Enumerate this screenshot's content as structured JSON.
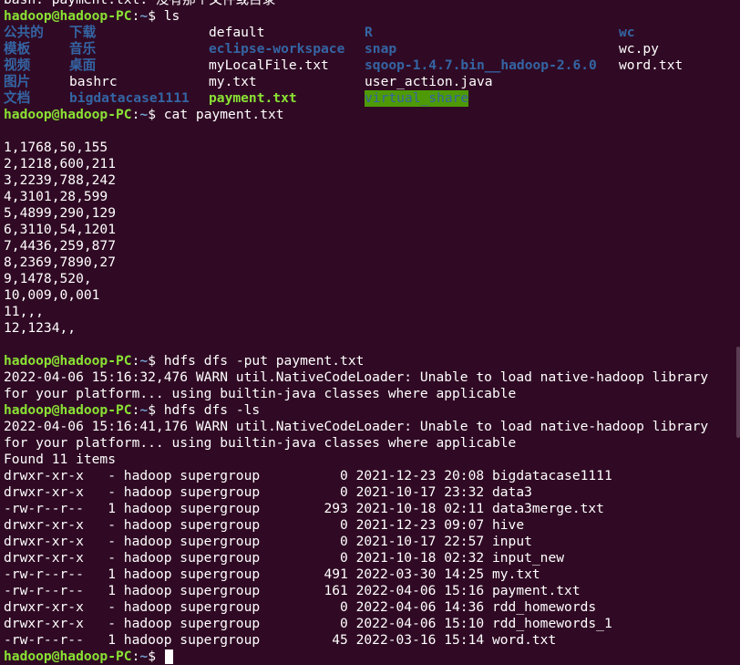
{
  "terminal": {
    "top_partial": "bash: payment.txt: 没有那个文件或目录",
    "prompt_user": "hadoop@hadoop-PC",
    "prompt_path": "~",
    "prompt_suffix": "$ ",
    "commands": {
      "ls": "ls",
      "cat": "cat payment.txt",
      "put": "hdfs dfs -put payment.txt",
      "hdfs_ls": "hdfs dfs -ls"
    },
    "ls_output": {
      "rows": [
        [
          "公共的",
          "下载",
          "default",
          "R",
          "wc"
        ],
        [
          "模板",
          "音乐",
          "eclipse-workspace",
          "snap",
          "wc.py"
        ],
        [
          "视频",
          "桌面",
          "myLocalFile.txt",
          "sqoop-1.4.7.bin__hadoop-2.6.0",
          "word.txt"
        ],
        [
          "图片",
          "bashrc",
          "my.txt",
          "user_action.java",
          ""
        ],
        [
          "文档",
          "bigdatacase1111",
          "payment.txt",
          "virtual_share",
          ""
        ]
      ]
    },
    "cat_output": [
      "1,1768,50,155",
      "2,1218,600,211",
      "3,2239,788,242",
      "4,3101,28,599",
      "5,4899,290,129",
      "6,3110,54,1201",
      "7,4436,259,877",
      "8,2369,7890,27",
      "9,1478,520,",
      "10,009,0,001",
      "11,,,",
      "12,1234,,"
    ],
    "warn_put_1": "2022-04-06 15:16:32,476 WARN util.NativeCodeLoader: Unable to load native-hadoop library",
    "warn_put_2": "for your platform... using builtin-java classes where applicable",
    "warn_ls_1": "2022-04-06 15:16:41,176 WARN util.NativeCodeLoader: Unable to load native-hadoop library",
    "warn_ls_2": "for your platform... using builtin-java classes where applicable",
    "found_items": "Found 11 items",
    "hdfs_listing": [
      "drwxr-xr-x   - hadoop supergroup          0 2021-12-23 20:08 bigdatacase1111",
      "drwxr-xr-x   - hadoop supergroup          0 2021-10-17 23:32 data3",
      "-rw-r--r--   1 hadoop supergroup        293 2021-10-18 02:11 data3merge.txt",
      "drwxr-xr-x   - hadoop supergroup          0 2021-12-23 09:07 hive",
      "drwxr-xr-x   - hadoop supergroup          0 2021-10-17 22:57 input",
      "drwxr-xr-x   - hadoop supergroup          0 2021-10-18 02:32 input_new",
      "-rw-r--r--   1 hadoop supergroup        491 2022-03-30 14:25 my.txt",
      "-rw-r--r--   1 hadoop supergroup        161 2022-04-06 15:16 payment.txt",
      "drwxr-xr-x   - hadoop supergroup          0 2022-04-06 14:36 rdd_homewords",
      "drwxr-xr-x   - hadoop supergroup          0 2022-04-06 15:10 rdd_homewords_1",
      "-rw-r--r--   1 hadoop supergroup         45 2022-03-16 15:14 word.txt"
    ]
  }
}
